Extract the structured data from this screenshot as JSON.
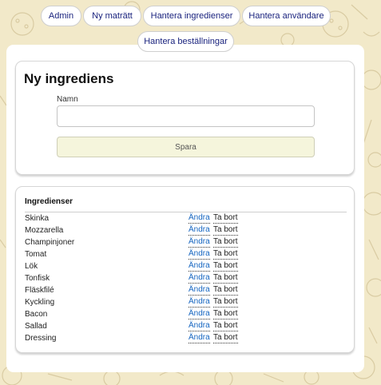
{
  "nav": {
    "tabs": [
      {
        "label": "Admin"
      },
      {
        "label": "Ny maträtt"
      },
      {
        "label": "Hantera ingredienser"
      },
      {
        "label": "Hantera användare"
      },
      {
        "label": "Hantera beställningar"
      }
    ]
  },
  "new_ingredient": {
    "title": "Ny ingrediens",
    "name_label": "Namn",
    "name_value": "",
    "name_placeholder": "",
    "save_label": "Spara"
  },
  "ingredients": {
    "header": "Ingredienser",
    "edit_label": "Ändra",
    "delete_label": "Ta bort",
    "items": [
      "Skinka",
      "Mozzarella",
      "Champinjoner",
      "Tomat",
      "Lök",
      "Tonfisk",
      "Fläskfilé",
      "Kyckling",
      "Bacon",
      "Sallad",
      "Dressing"
    ]
  },
  "colors": {
    "background": "#f2e9c9",
    "link": "#1565c0",
    "button_bg": "#f5f5dc",
    "tab_text": "#1a237e"
  }
}
